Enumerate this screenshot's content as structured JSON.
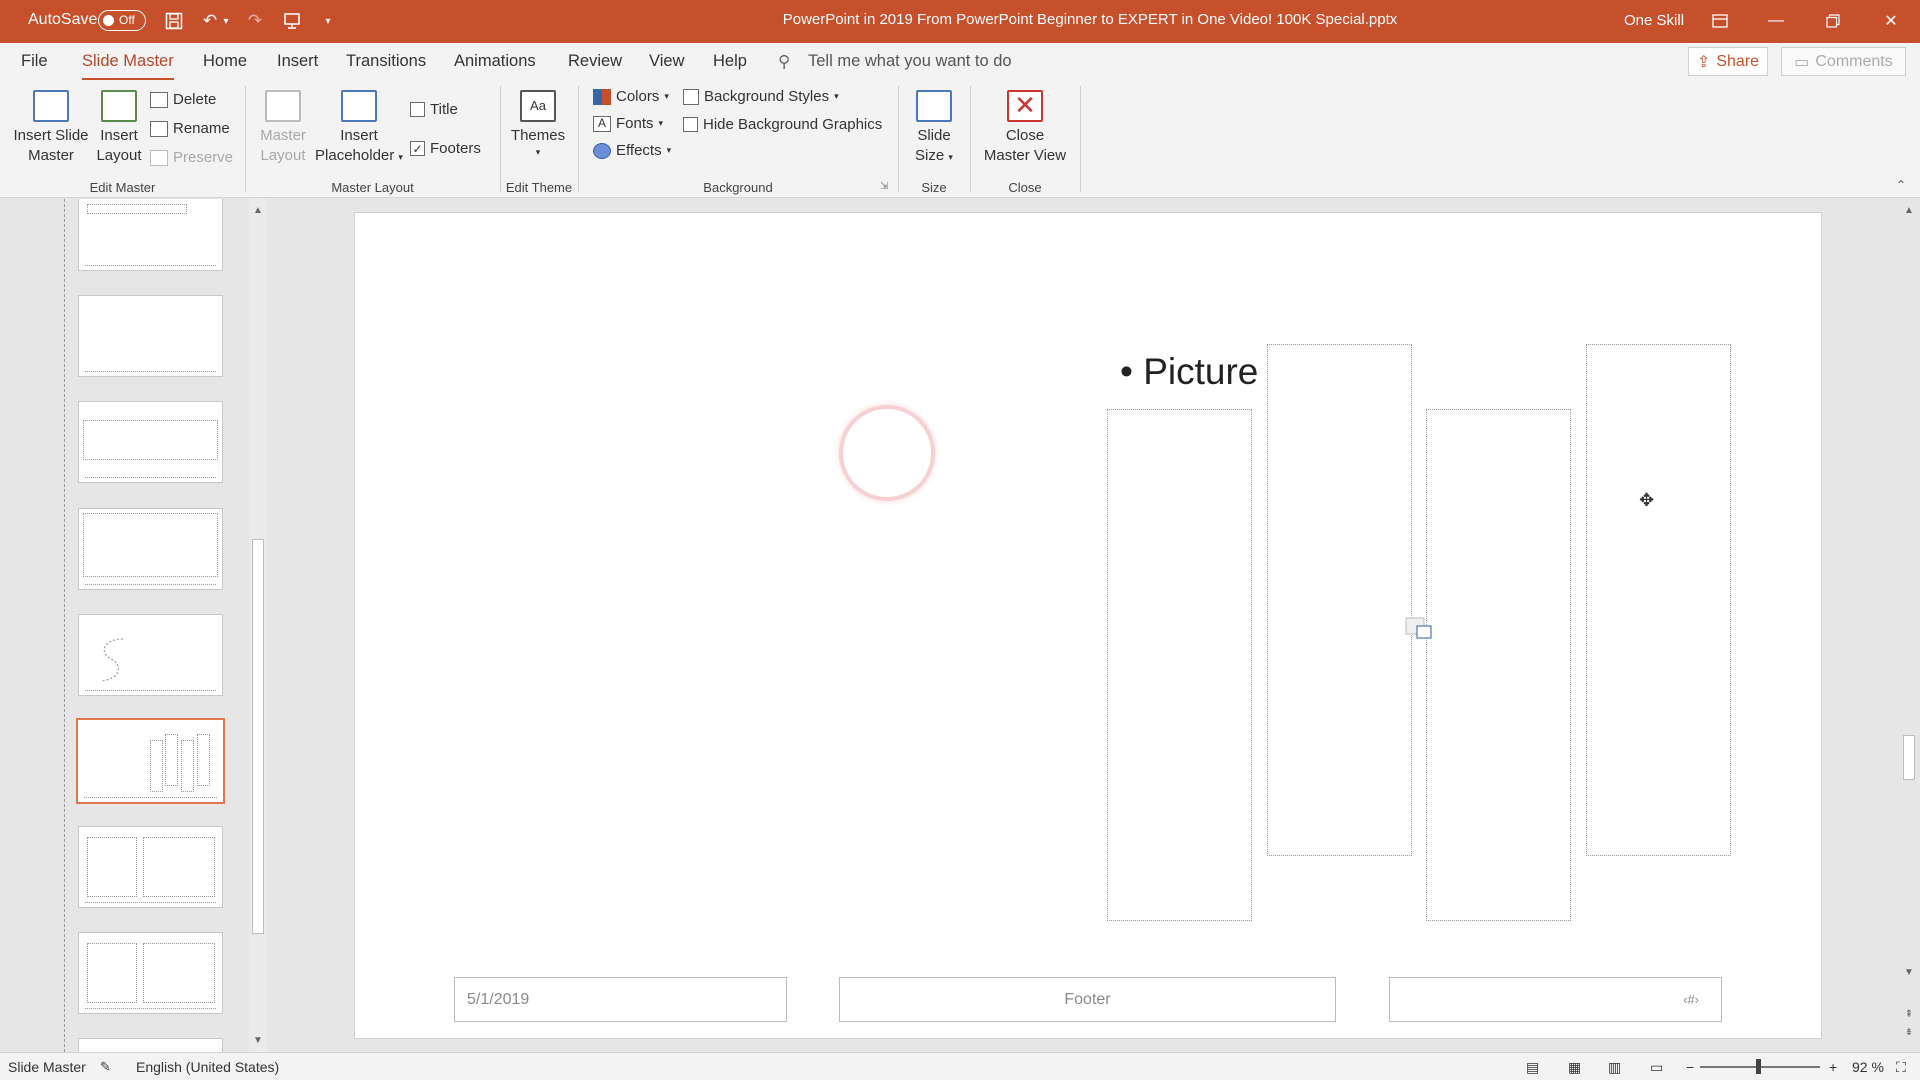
{
  "titlebar": {
    "autosave_label": "AutoSave",
    "autosave_state": "Off",
    "document_title": "PowerPoint in 2019 From PowerPoint Beginner to EXPERT in One Video! 100K Special.pptx",
    "user_name": "One Skill"
  },
  "tabs": [
    "File",
    "Slide Master",
    "Home",
    "Insert",
    "Transitions",
    "Animations",
    "Review",
    "View",
    "Help"
  ],
  "active_tab": "Slide Master",
  "tell_me": "Tell me what you want to do",
  "share_label": "Share",
  "comments_label": "Comments",
  "ribbon": {
    "edit_master": {
      "label": "Edit Master",
      "insert_slide_master": [
        "Insert Slide",
        "Master"
      ],
      "insert_layout": [
        "Insert",
        "Layout"
      ],
      "delete": "Delete",
      "rename": "Rename",
      "preserve": "Preserve"
    },
    "master_layout": {
      "label": "Master Layout",
      "master_layout_btn": [
        "Master",
        "Layout"
      ],
      "insert_placeholder": [
        "Insert",
        "Placeholder"
      ],
      "title_check": "Title",
      "title_checked": false,
      "footers_check": "Footers",
      "footers_checked": true
    },
    "edit_theme": {
      "label": "Edit Theme",
      "themes": "Themes"
    },
    "background": {
      "label": "Background",
      "colors": "Colors",
      "fonts": "Fonts",
      "effects": "Effects",
      "background_styles": "Background Styles",
      "hide_background_graphics": "Hide Background Graphics",
      "hide_checked": false
    },
    "size": {
      "label": "Size",
      "slide_size": [
        "Slide",
        "Size"
      ]
    },
    "close": {
      "label": "Close",
      "close_master_view": [
        "Close",
        "Master View"
      ]
    }
  },
  "slide": {
    "bullet_text": "Picture",
    "footer_date": "5/1/2019",
    "footer_text": "Footer",
    "footer_number": "‹#›"
  },
  "statusbar": {
    "view_name": "Slide Master",
    "language": "English (United States)",
    "zoom": "92 %"
  },
  "colors": {
    "accent": "#c6502c",
    "selected_thumb_border": "#e0754f"
  }
}
